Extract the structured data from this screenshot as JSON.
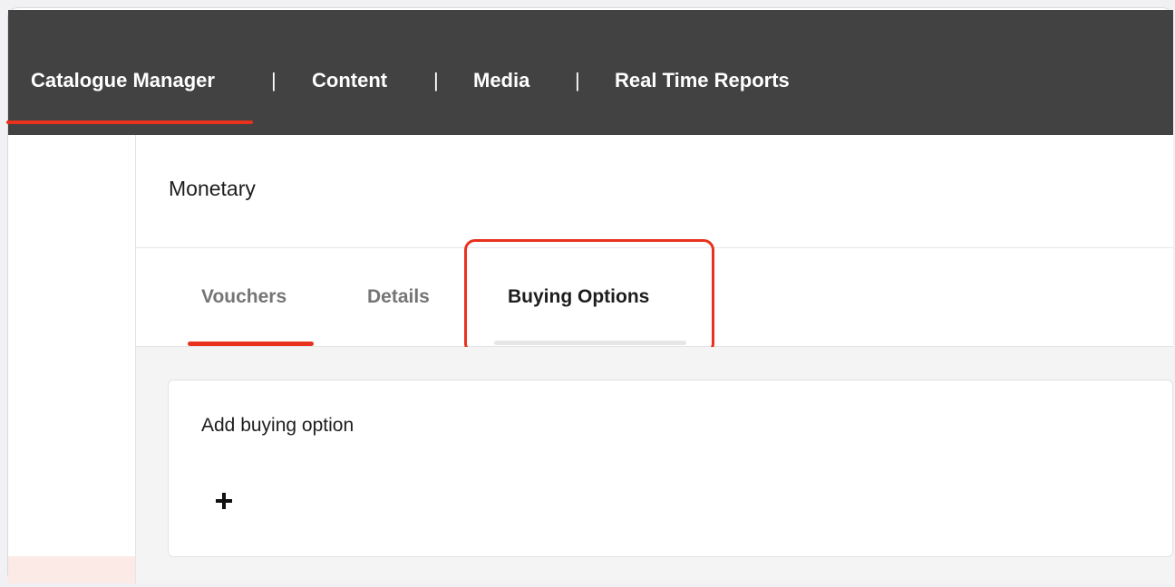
{
  "topnav": {
    "items": [
      {
        "label": "Catalogue Manager"
      },
      {
        "label": "Content"
      },
      {
        "label": "Media"
      },
      {
        "label": "Real Time Reports"
      }
    ],
    "separator": "|"
  },
  "page": {
    "title": "Monetary"
  },
  "tabs": [
    {
      "label": "Vouchers",
      "active": true
    },
    {
      "label": "Details"
    },
    {
      "label": "Buying Options",
      "highlighted": true
    }
  ],
  "card": {
    "title": "Add buying option",
    "add_icon": "plus-icon"
  },
  "colors": {
    "accent": "#e8321e",
    "nav_bg": "#424242"
  }
}
